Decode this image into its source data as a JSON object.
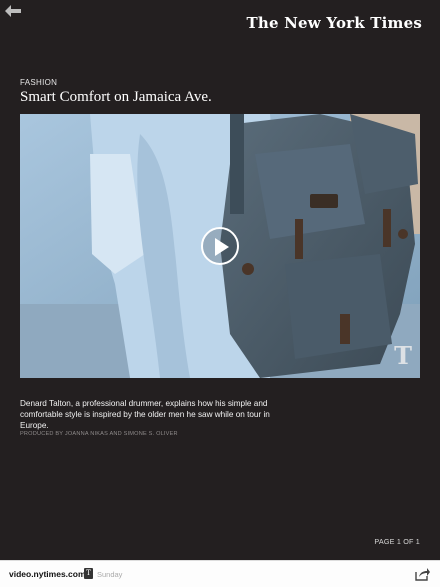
{
  "header": {
    "back_icon": "back-arrow-icon",
    "masthead": "The New York Times"
  },
  "article": {
    "section": "FASHION",
    "title": "Smart Comfort on Jamaica Ave.",
    "video": {
      "play_icon": "play-icon",
      "watermark": "T"
    },
    "caption": "Denard Talton, a professional drummer, explains how his simple and comfortable style is inspired by the older men he saw while on tour in Europe.",
    "credit": "PRODUCED BY JOANNA NIKAS AND SIMONE S. OLIVER"
  },
  "pager": "PAGE 1 OF 1",
  "bottom_bar": {
    "site": "video.nytimes.com",
    "badge": "T",
    "day": "Sunday",
    "share_icon": "share-icon"
  },
  "colors": {
    "background": "#231f20",
    "bottom_bar": "#fdfdfd"
  }
}
